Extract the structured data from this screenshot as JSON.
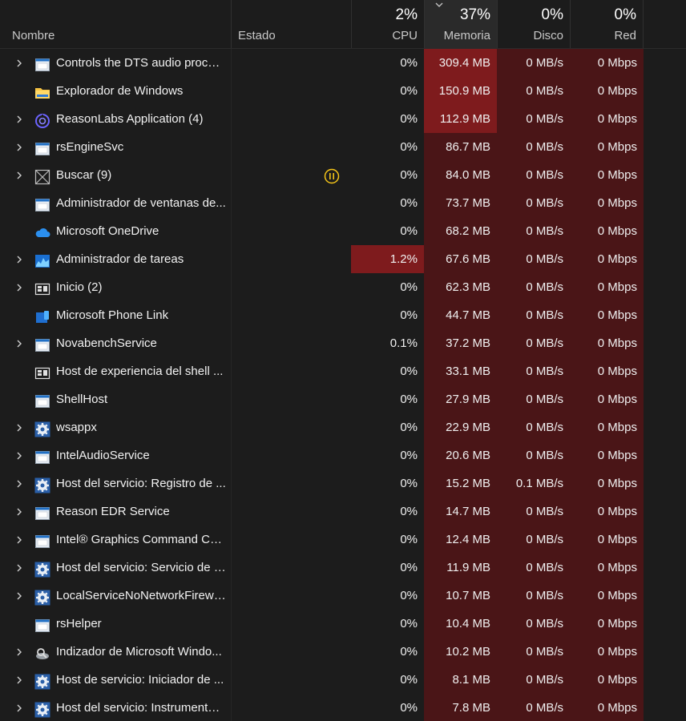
{
  "columns": {
    "name": "Nombre",
    "status": "Estado",
    "cpu": {
      "label": "CPU",
      "pct": "2%"
    },
    "memory": {
      "label": "Memoria",
      "pct": "37%"
    },
    "disk": {
      "label": "Disco",
      "pct": "0%"
    },
    "network": {
      "label": "Red",
      "pct": "0%"
    }
  },
  "sort_icon": "chevron-down-icon",
  "heat_colors": {
    "base": "#4a1517",
    "warm": "#6b1a1c",
    "hot": "#7e1b1d"
  },
  "processes": [
    {
      "name": "Controls the DTS audio proces...",
      "icon": "app-window-icon",
      "expandable": true,
      "status": "",
      "cpu": "0%",
      "memory": "309.4 MB",
      "disk": "0 MB/s",
      "network": "0 Mbps"
    },
    {
      "name": "Explorador de Windows",
      "icon": "folder-icon",
      "expandable": false,
      "status": "",
      "cpu": "0%",
      "memory": "150.9 MB",
      "disk": "0 MB/s",
      "network": "0 Mbps"
    },
    {
      "name": "ReasonLabs Application (4)",
      "icon": "reasonlabs-icon",
      "expandable": true,
      "status": "",
      "cpu": "0%",
      "memory": "112.9 MB",
      "disk": "0 MB/s",
      "network": "0 Mbps"
    },
    {
      "name": "rsEngineSvc",
      "icon": "app-window-icon",
      "expandable": true,
      "status": "",
      "cpu": "0%",
      "memory": "86.7 MB",
      "disk": "0 MB/s",
      "network": "0 Mbps"
    },
    {
      "name": "Buscar (9)",
      "icon": "search-placeholder-icon",
      "expandable": true,
      "status": "suspended",
      "cpu": "0%",
      "memory": "84.0 MB",
      "disk": "0 MB/s",
      "network": "0 Mbps"
    },
    {
      "name": "Administrador de ventanas de...",
      "icon": "app-window-icon",
      "expandable": false,
      "status": "",
      "cpu": "0%",
      "memory": "73.7 MB",
      "disk": "0 MB/s",
      "network": "0 Mbps"
    },
    {
      "name": "Microsoft OneDrive",
      "icon": "cloud-icon",
      "expandable": false,
      "status": "",
      "cpu": "0%",
      "memory": "68.2 MB",
      "disk": "0 MB/s",
      "network": "0 Mbps"
    },
    {
      "name": "Administrador de tareas",
      "icon": "task-manager-icon",
      "expandable": true,
      "status": "",
      "cpu": "1.2%",
      "memory": "67.6 MB",
      "disk": "0 MB/s",
      "network": "0 Mbps"
    },
    {
      "name": "Inicio (2)",
      "icon": "start-window-icon",
      "expandable": true,
      "status": "",
      "cpu": "0%",
      "memory": "62.3 MB",
      "disk": "0 MB/s",
      "network": "0 Mbps"
    },
    {
      "name": "Microsoft Phone Link",
      "icon": "phone-link-icon",
      "expandable": false,
      "status": "",
      "cpu": "0%",
      "memory": "44.7 MB",
      "disk": "0 MB/s",
      "network": "0 Mbps"
    },
    {
      "name": "NovabenchService",
      "icon": "app-window-icon",
      "expandable": true,
      "status": "",
      "cpu": "0.1%",
      "memory": "37.2 MB",
      "disk": "0 MB/s",
      "network": "0 Mbps"
    },
    {
      "name": "Host de experiencia del shell ...",
      "icon": "start-window-icon",
      "expandable": false,
      "status": "",
      "cpu": "0%",
      "memory": "33.1 MB",
      "disk": "0 MB/s",
      "network": "0 Mbps"
    },
    {
      "name": "ShellHost",
      "icon": "app-window-icon",
      "expandable": false,
      "status": "",
      "cpu": "0%",
      "memory": "27.9 MB",
      "disk": "0 MB/s",
      "network": "0 Mbps"
    },
    {
      "name": "wsappx",
      "icon": "gear-icon",
      "expandable": true,
      "status": "",
      "cpu": "0%",
      "memory": "22.9 MB",
      "disk": "0 MB/s",
      "network": "0 Mbps"
    },
    {
      "name": "IntelAudioService",
      "icon": "app-window-icon",
      "expandable": true,
      "status": "",
      "cpu": "0%",
      "memory": "20.6 MB",
      "disk": "0 MB/s",
      "network": "0 Mbps"
    },
    {
      "name": "Host del servicio: Registro de ...",
      "icon": "gear-icon",
      "expandable": true,
      "status": "",
      "cpu": "0%",
      "memory": "15.2 MB",
      "disk": "0.1 MB/s",
      "network": "0 Mbps"
    },
    {
      "name": "Reason EDR Service",
      "icon": "app-window-icon",
      "expandable": true,
      "status": "",
      "cpu": "0%",
      "memory": "14.7 MB",
      "disk": "0 MB/s",
      "network": "0 Mbps"
    },
    {
      "name": "Intel® Graphics Command Ce...",
      "icon": "app-window-icon",
      "expandable": true,
      "status": "",
      "cpu": "0%",
      "memory": "12.4 MB",
      "disk": "0 MB/s",
      "network": "0 Mbps"
    },
    {
      "name": "Host del servicio: Servicio de r...",
      "icon": "gear-icon",
      "expandable": true,
      "status": "",
      "cpu": "0%",
      "memory": "11.9 MB",
      "disk": "0 MB/s",
      "network": "0 Mbps"
    },
    {
      "name": "LocalServiceNoNetworkFirewa...",
      "icon": "gear-icon",
      "expandable": true,
      "status": "",
      "cpu": "0%",
      "memory": "10.7 MB",
      "disk": "0 MB/s",
      "network": "0 Mbps"
    },
    {
      "name": "rsHelper",
      "icon": "app-window-icon",
      "expandable": false,
      "status": "",
      "cpu": "0%",
      "memory": "10.4 MB",
      "disk": "0 MB/s",
      "network": "0 Mbps"
    },
    {
      "name": "Indizador de Microsoft Windo...",
      "icon": "indexer-icon",
      "expandable": true,
      "status": "",
      "cpu": "0%",
      "memory": "10.2 MB",
      "disk": "0 MB/s",
      "network": "0 Mbps"
    },
    {
      "name": "Host de servicio: Iniciador de ...",
      "icon": "gear-icon",
      "expandable": true,
      "status": "",
      "cpu": "0%",
      "memory": "8.1 MB",
      "disk": "0 MB/s",
      "network": "0 Mbps"
    },
    {
      "name": "Host del servicio: Instrumental...",
      "icon": "gear-icon",
      "expandable": true,
      "status": "",
      "cpu": "0%",
      "memory": "7.8 MB",
      "disk": "0 MB/s",
      "network": "0 Mbps"
    }
  ]
}
